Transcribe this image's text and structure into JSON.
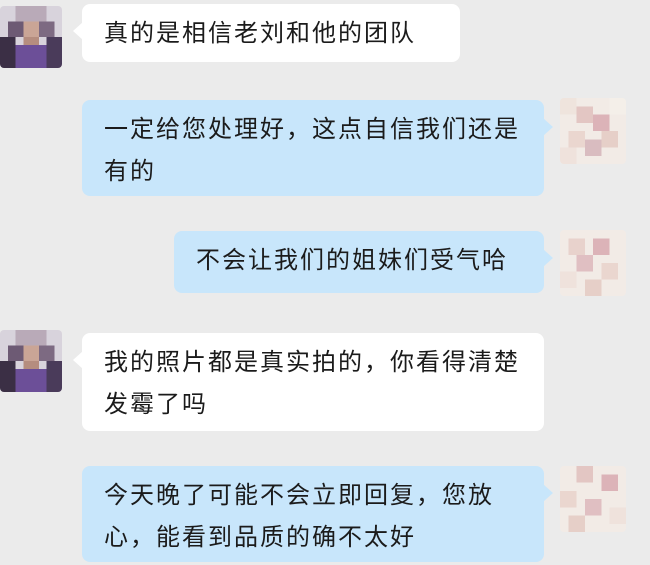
{
  "colors": {
    "background": "#ebebeb",
    "incoming_bubble": "#ffffff",
    "outgoing_bubble": "#c8e6fb"
  },
  "messages": [
    {
      "direction": "incoming",
      "text": "真的是相信老刘和他的团队"
    },
    {
      "direction": "outgoing",
      "text": "一定给您处理好，这点自信我们还是有的"
    },
    {
      "direction": "outgoing",
      "text": "不会让我们的姐妹们受气哈"
    },
    {
      "direction": "incoming",
      "text": "我的照片都是真实拍的，你看得清楚发霉了吗"
    },
    {
      "direction": "outgoing",
      "text": "今天晚了可能不会立即回复，您放心，能看到品质的确不太好"
    }
  ]
}
